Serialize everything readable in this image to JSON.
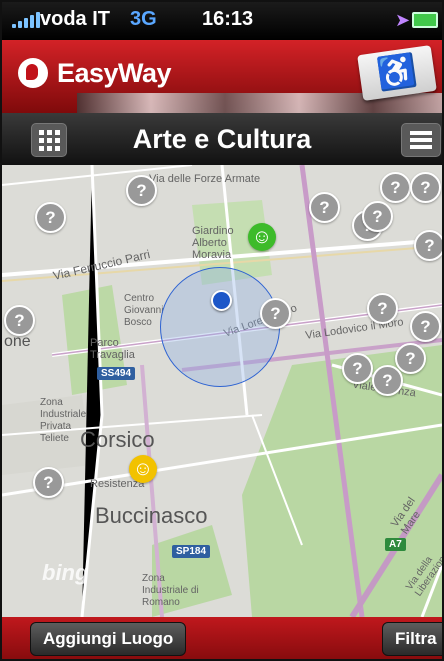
{
  "status_bar": {
    "carrier": "voda IT",
    "network": "3G",
    "time": "16:13",
    "signal_icon": "signal-bars-icon",
    "location_icon": "location-arrow-icon",
    "battery_icon": "battery-icon"
  },
  "app": {
    "name": "EasyWay",
    "logo": "vodafone-logo",
    "accessibility_icon": "wheelchair-icon"
  },
  "nav": {
    "title": "Arte e Cultura",
    "left_icon": "grid-icon",
    "right_icon": "menu-icon"
  },
  "map": {
    "streets": [
      "Via delle Forze Armate",
      "Via Ferruccio Parri",
      "Via Lorenteggio",
      "Via Lodovico il Moro",
      "Viale Faenza",
      "Via del Mare",
      "Via della Liberazione"
    ],
    "places": [
      "Giardino Alberto Moravia",
      "Centro Giovanni Bosco",
      "Parco Travaglia",
      "Zona Industriale Privata Teliete",
      "Corsico",
      "Buccinasco",
      "Resistenza",
      "Zona Industriale di Romano",
      "one"
    ],
    "road_tags": [
      "SS494",
      "SP184",
      "A7"
    ],
    "provider": "bing",
    "markers": {
      "unknown_label": "?",
      "happy_color": "#3dbb2a",
      "neutral_color": "#f2c200"
    }
  },
  "footer": {
    "add_place": "Aggiungi Luogo",
    "filter": "Filtra"
  },
  "colors": {
    "brand_red": "#d32227",
    "nav_dark": "#111111"
  }
}
